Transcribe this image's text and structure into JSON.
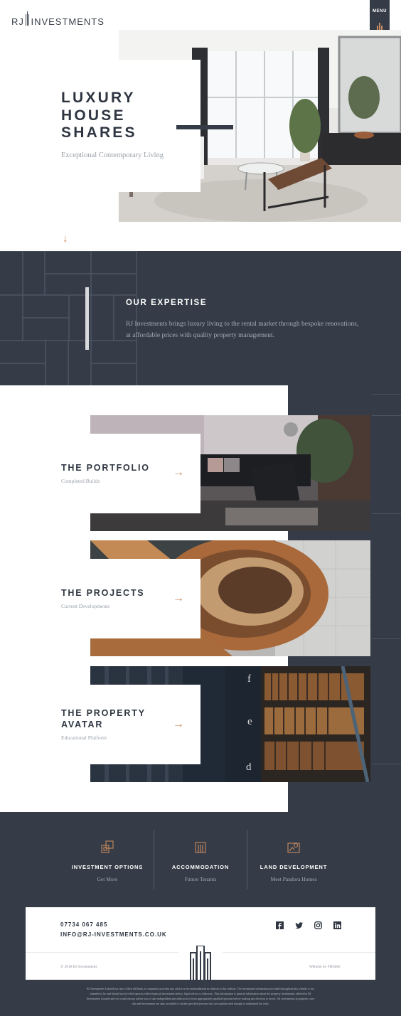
{
  "header": {
    "logo_rj": "RJ",
    "logo_name": "INVESTMENTS",
    "menu_label": "MENU"
  },
  "hero": {
    "title_lines": [
      "LUXURY",
      "HOUSE",
      "SHARES"
    ],
    "subtitle": "Exceptional Contemporary Living",
    "scroll_icon": "arrow-down-icon"
  },
  "expertise": {
    "title": "OUR EXPERTISE",
    "text": "RJ Investments brings luxury living to the rental market through bespoke renovations, at affordable prices with quality property management."
  },
  "cards": [
    {
      "title_lines": [
        "THE PORTFOLIO"
      ],
      "subtitle": "Completed Builds",
      "arrow": "→",
      "image": "living-room-photo"
    },
    {
      "title_lines": [
        "THE PROJECTS"
      ],
      "subtitle": "Current Developments",
      "arrow": "→",
      "image": "spiral-staircase-photo"
    },
    {
      "title_lines": [
        "THE PROPERTY",
        "AVATAR"
      ],
      "subtitle": "Educational Platform",
      "arrow": "→",
      "image": "bookshelf-photo"
    }
  ],
  "services": [
    {
      "icon": "investment-icon",
      "title": "INVESTMENT OPTIONS",
      "subtitle": "Get More"
    },
    {
      "icon": "building-icon",
      "title": "ACCOMMODATION",
      "subtitle": "Future Tenants"
    },
    {
      "icon": "land-icon",
      "title": "LAND DEVELOPMENT",
      "subtitle": "Meet Pandora Homes"
    }
  ],
  "footer": {
    "phone": "07734 067 485",
    "email": "INFO@RJ-INVESTMENTS.CO.UK",
    "socials": [
      "facebook-icon",
      "twitter-icon",
      "instagram-icon",
      "linkedin-icon"
    ],
    "copyright": "© 2018 RJ Investments",
    "credit": "Website by FHOKE",
    "disclaimer": "RJ Investments Limited nor any of their affiliates or companies provides any advice or recommendations in relation to this website. The investment information provided throughout this website is not intended to be and should not be relied upon as either financial investment advice, legal advice or otherwise. This information is general information about the property investments offered by RJ Investments Limited and we would always advise you to take independent specialist advice from appropriately qualified persons before making any decision to invest. All investments in property carry risk and investments are only available to certain specified persons who are sophisticated enough to understand the risks."
  },
  "colors": {
    "navy": "#353c47",
    "accent": "#c98a5e",
    "muted_text": "#9aa0a8"
  }
}
